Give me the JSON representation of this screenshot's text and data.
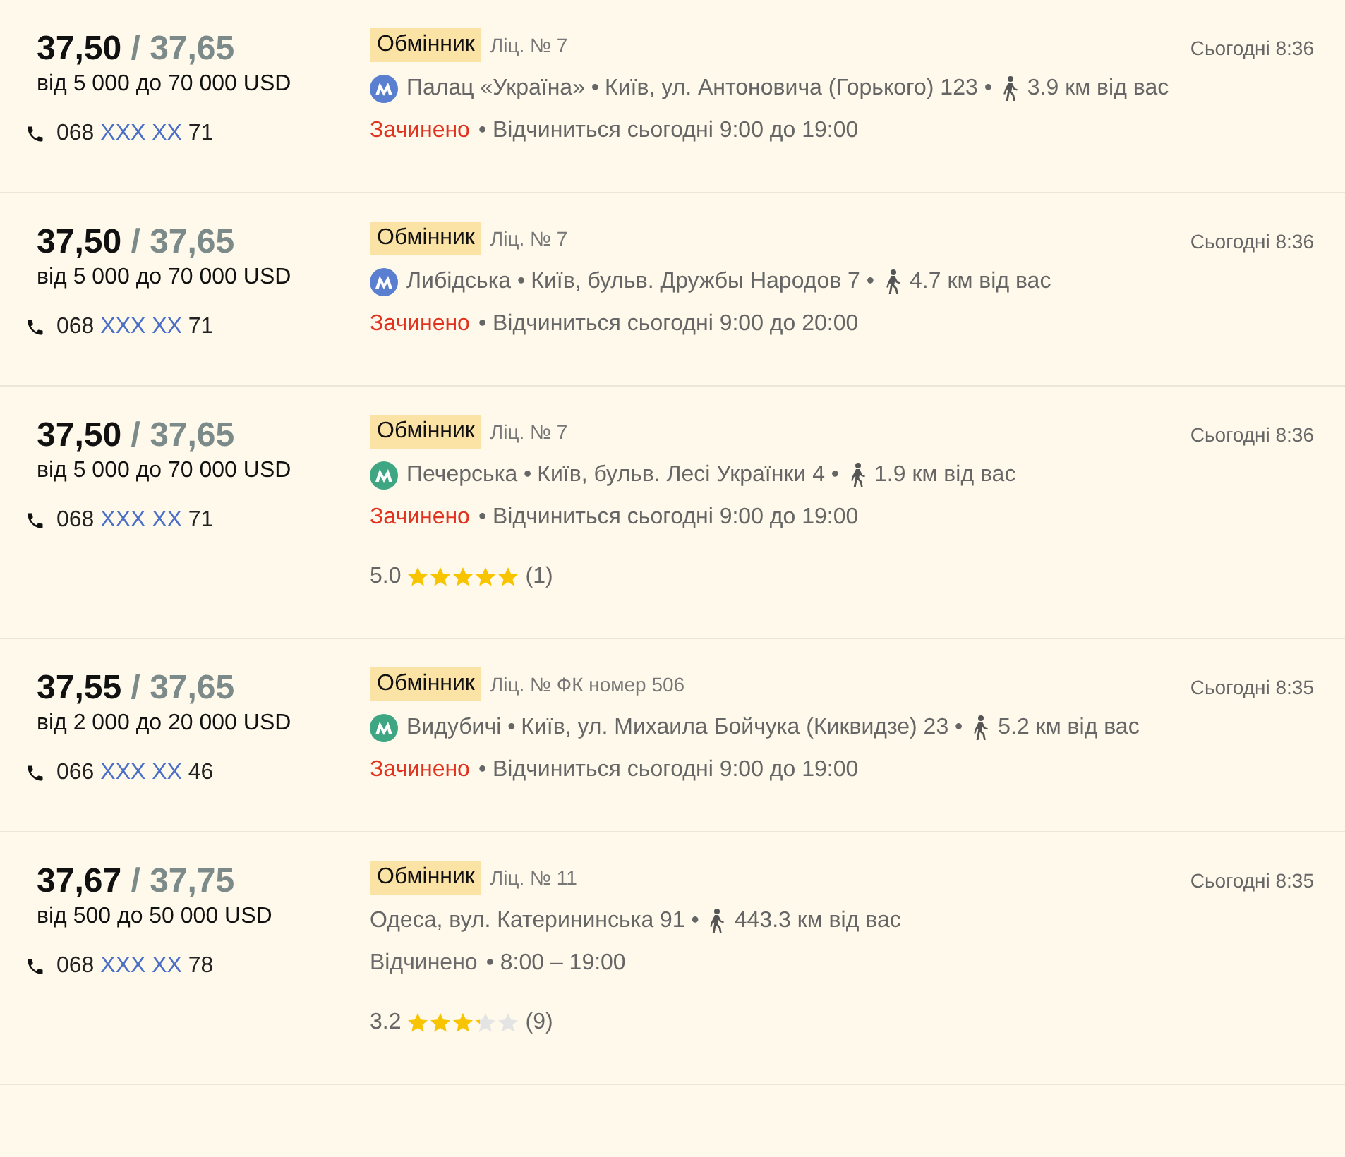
{
  "offers": [
    {
      "buy": "37,50",
      "sell": "/ 37,65",
      "range": "від 5 000 до 70 000 USD",
      "phone": {
        "prefix": "068",
        "hidden": "XXX XX",
        "suffix": "71"
      },
      "tag": "Обмінник",
      "license": "Ліц. № 7",
      "metro": {
        "name": "Палац «Україна» •",
        "color": "#5b7fd0"
      },
      "address": "Київ, ул. Антоновича (Горького) 123 •",
      "distance": "3.9  км від вас",
      "status": {
        "kind": "closed",
        "text": "Зачинено"
      },
      "hours": "• Відчиниться сьогодні 9:00 до 19:00",
      "time": "Сьогодні 8:36"
    },
    {
      "buy": "37,50",
      "sell": "/ 37,65",
      "range": "від 5 000 до 70 000 USD",
      "phone": {
        "prefix": "068",
        "hidden": "XXX XX",
        "suffix": "71"
      },
      "tag": "Обмінник",
      "license": "Ліц. № 7",
      "metro": {
        "name": "Либідська •",
        "color": "#5b7fd0"
      },
      "address": "Київ, бульв. Дружбы Народов 7 •",
      "distance": "4.7  км від вас",
      "status": {
        "kind": "closed",
        "text": "Зачинено"
      },
      "hours": "• Відчиниться сьогодні 9:00 до 20:00",
      "time": "Сьогодні 8:36"
    },
    {
      "buy": "37,50",
      "sell": "/ 37,65",
      "range": "від 5 000 до 70 000 USD",
      "phone": {
        "prefix": "068",
        "hidden": "XXX XX",
        "suffix": "71"
      },
      "tag": "Обмінник",
      "license": "Ліц. № 7",
      "metro": {
        "name": "Печерська •",
        "color": "#3ea683"
      },
      "address": "Київ, бульв. Лесі Українки 4 •",
      "distance": "1.9  км від вас",
      "status": {
        "kind": "closed",
        "text": "Зачинено"
      },
      "hours": "• Відчиниться сьогодні 9:00 до 19:00",
      "rating": {
        "score": "5.0",
        "stars": 5,
        "count": "(1)"
      },
      "time": "Сьогодні 8:36"
    },
    {
      "buy": "37,55",
      "sell": "/ 37,65",
      "range": "від 2 000 до 20 000 USD",
      "phone": {
        "prefix": "066",
        "hidden": "XXX XX",
        "suffix": "46"
      },
      "tag": "Обмінник",
      "license": "Ліц. № ФК номер 506",
      "metro": {
        "name": "Видубичі •",
        "color": "#3ea683"
      },
      "address": "Київ, ул. Михаила Бойчука (Киквидзе) 23 •",
      "distance": "5.2  км від вас",
      "status": {
        "kind": "closed",
        "text": "Зачинено"
      },
      "hours": "• Відчиниться сьогодні 9:00 до 19:00",
      "time": "Сьогодні 8:35"
    },
    {
      "buy": "37,67",
      "sell": "/ 37,75",
      "range": "від 500 до 50 000 USD",
      "phone": {
        "prefix": "068",
        "hidden": "XXX XX",
        "suffix": "78"
      },
      "tag": "Обмінник",
      "license": "Ліц. № 11",
      "address": "Одеса, вул. Катерининська 91 •",
      "distance": "443.3  км від вас",
      "status": {
        "kind": "open",
        "text": "Відчинено"
      },
      "hours": "• 8:00 – 19:00",
      "rating": {
        "score": "3.2",
        "stars": 3.2,
        "count": "(9)"
      },
      "time": "Сьогодні 8:35"
    }
  ]
}
